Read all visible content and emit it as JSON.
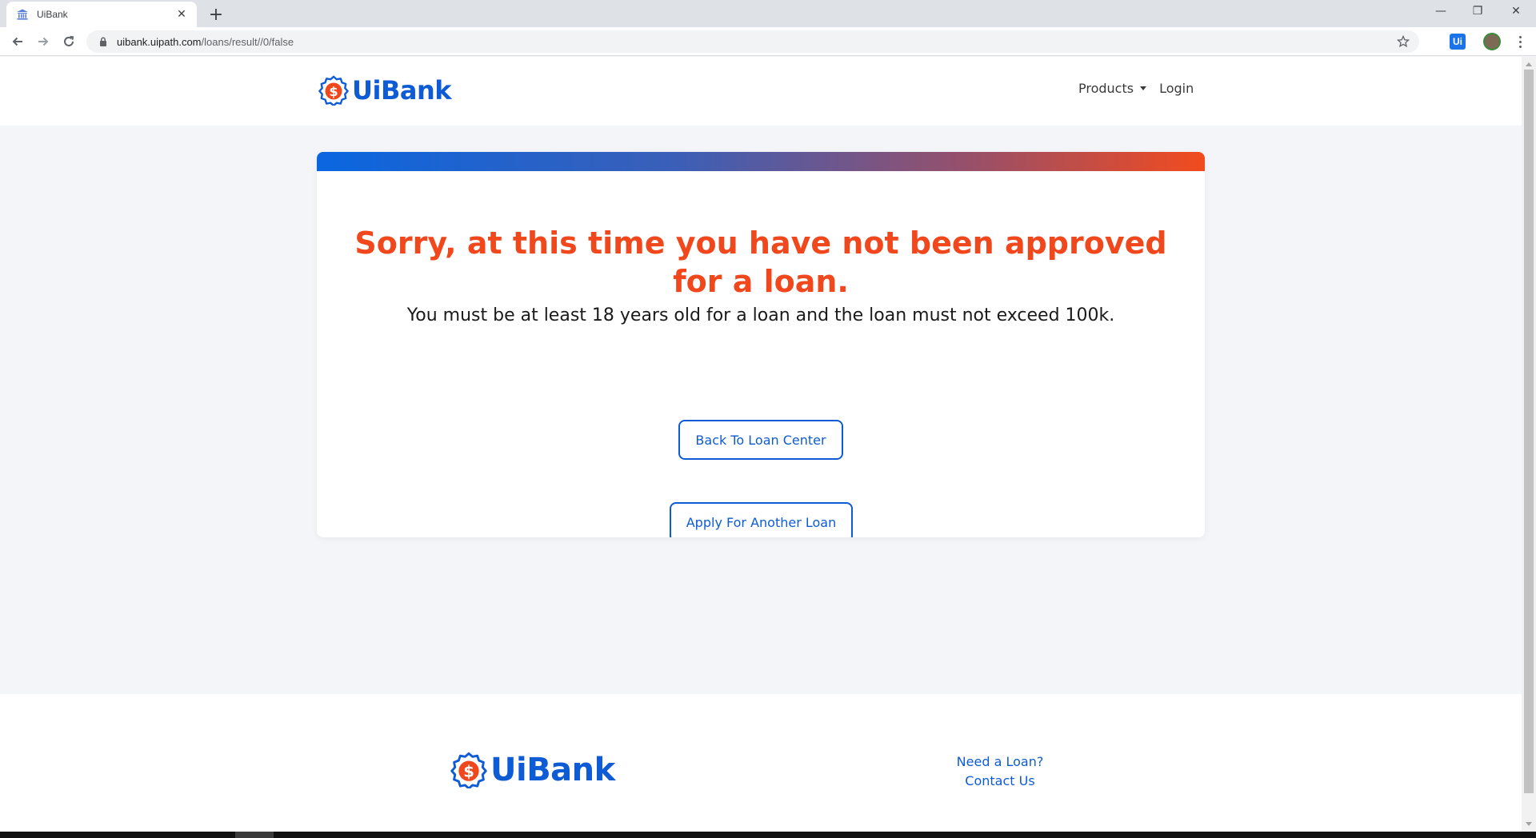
{
  "browser": {
    "tab_title": "UiBank",
    "tab_close": "✕",
    "new_tab": "+",
    "window_controls": {
      "minimize": "—",
      "restore": "❐",
      "close": "✕"
    },
    "url_domain": "uibank.uipath.com",
    "url_path": "/loans/result//0/false",
    "extension_label": "Ui"
  },
  "header": {
    "logo_text": "UiBank",
    "nav": {
      "products_label": "Products",
      "login_label": "Login"
    }
  },
  "result": {
    "title": "Sorry, at this time you have not been approved for a loan.",
    "message": "You must be at least 18 years old for a loan and the loan must not exceed 100k.",
    "back_button": "Back To Loan Center",
    "apply_button": "Apply For Another Loan"
  },
  "footer": {
    "logo_text": "UiBank",
    "links": {
      "need_loan": "Need a Loan?",
      "contact": "Contact Us"
    }
  },
  "colors": {
    "brand_blue": "#0e5bd6",
    "brand_orange": "#f0481c",
    "page_bg": "#f4f5f9"
  },
  "icons": [
    "bank-icon",
    "back-arrow-icon",
    "forward-arrow-icon",
    "reload-icon",
    "lock-icon",
    "star-icon",
    "dollar-badge-icon",
    "caret-down-icon",
    "menu-dots-icon"
  ]
}
